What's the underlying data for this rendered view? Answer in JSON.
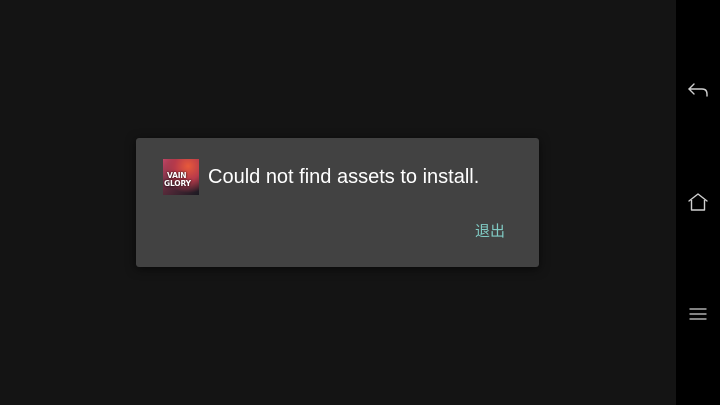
{
  "dialog": {
    "app_icon_text_line1": "VAIN",
    "app_icon_text_line2": "GLORY",
    "message": "Could not find assets to install.",
    "exit_label": "退出"
  },
  "navbar": {
    "buttons": [
      {
        "icon": "back-icon"
      },
      {
        "icon": "home-icon"
      },
      {
        "icon": "menu-icon"
      }
    ]
  },
  "colors": {
    "background": "#141414",
    "dialog_background": "#424242",
    "accent": "#80cbc4",
    "navbar": "#000000"
  }
}
